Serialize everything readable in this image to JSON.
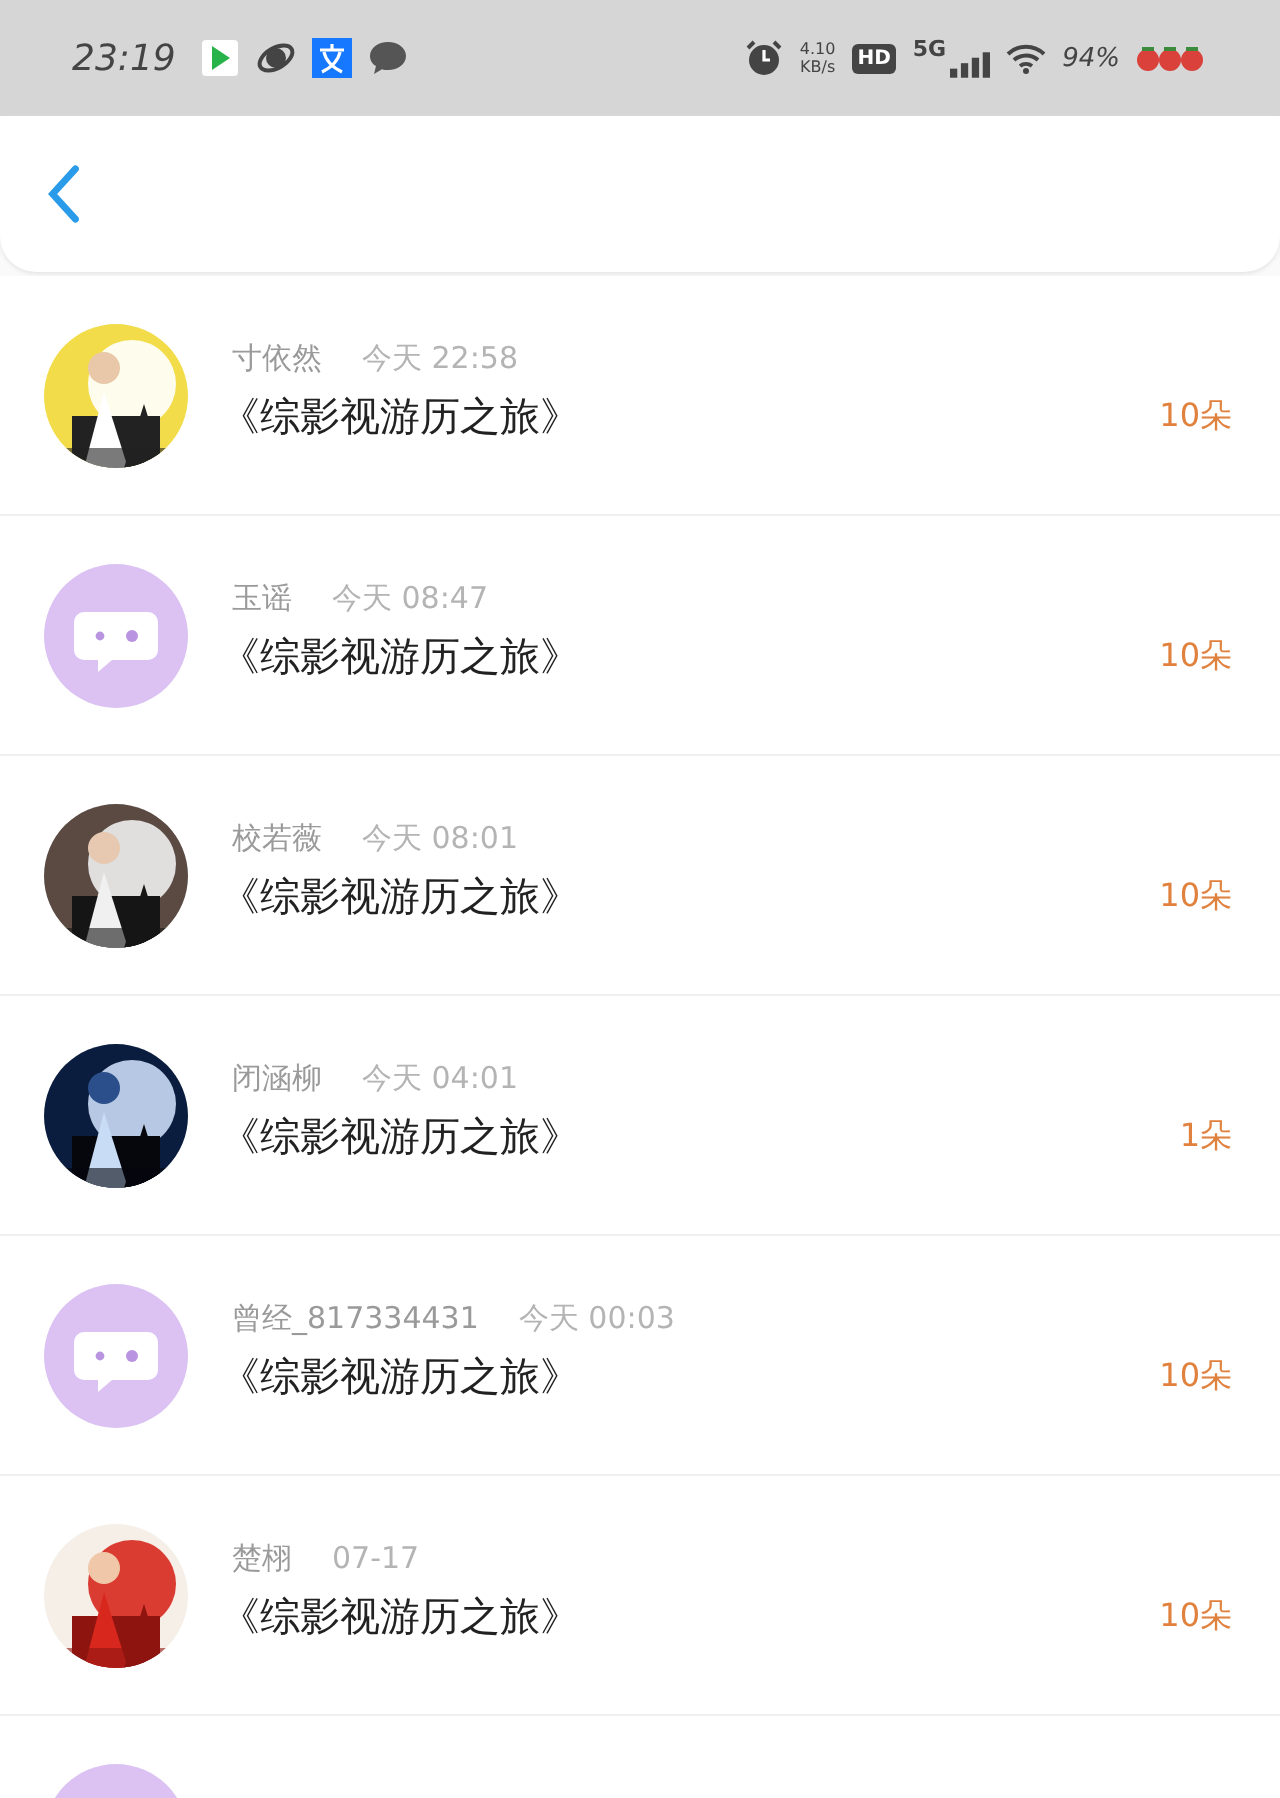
{
  "status_bar": {
    "time": "23:19",
    "net_speed": "4.10",
    "net_unit": "KB/s",
    "hd": "HD",
    "network": "5G",
    "battery": "94%"
  },
  "rows": [
    {
      "name": "寸依然",
      "time": "今天 22:58",
      "title": "《综影视游历之旅》",
      "amount": "10朵"
    },
    {
      "avatar": {
        "kind": "default"
      },
      "name": "玉谣",
      "time": "今天 08:47",
      "title": "《综影视游历之旅》",
      "amount": "10朵"
    },
    {
      "name": "校若薇",
      "time": "今天 08:01",
      "title": "《综影视游历之旅》",
      "amount": "10朵"
    },
    {
      "name": "闭涵柳",
      "time": "今天 04:01",
      "title": "《综影视游历之旅》",
      "amount": "1朵"
    },
    {
      "avatar": {
        "kind": "default"
      },
      "name": "曾经_817334431",
      "time": "今天 00:03",
      "title": "《综影视游历之旅》",
      "amount": "10朵"
    },
    {
      "name": "楚栩",
      "time": "07-17",
      "title": "《综影视游历之旅》",
      "amount": "10朵"
    },
    {
      "avatar": {
        "kind": "default"
      }
    }
  ]
}
